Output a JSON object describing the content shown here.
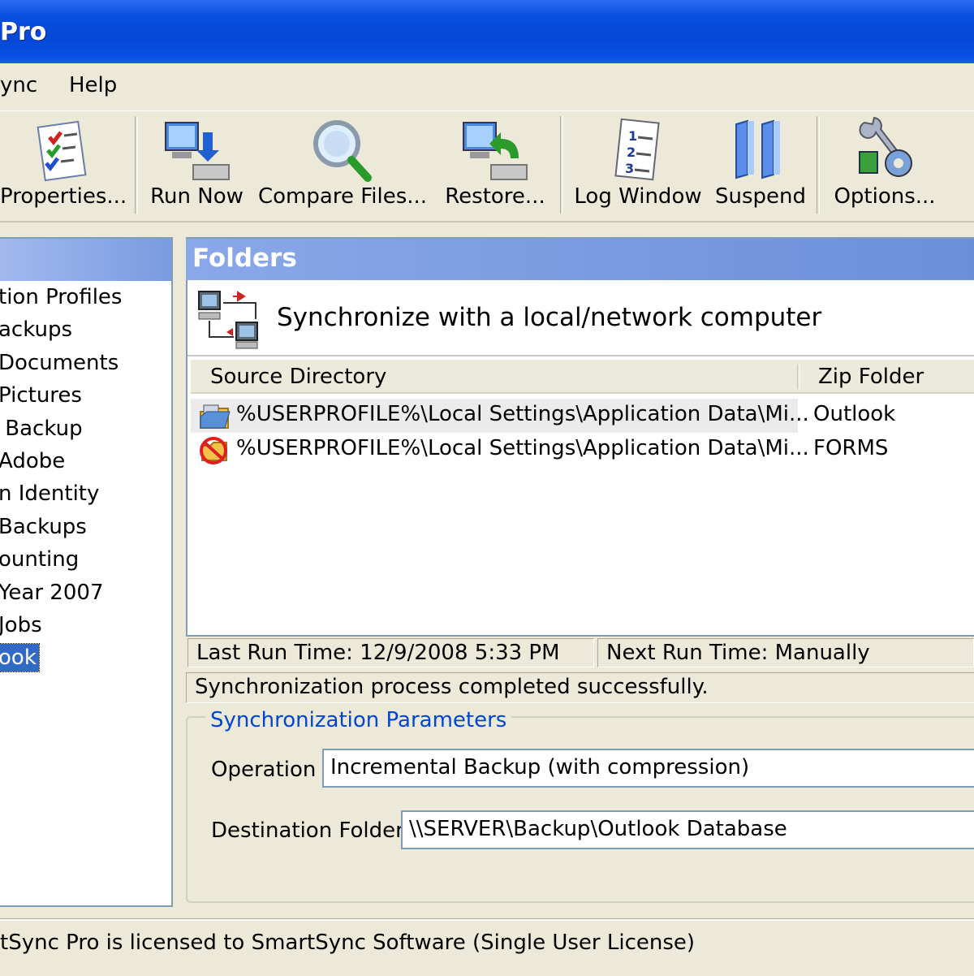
{
  "window": {
    "title": "Pro"
  },
  "menu": [
    "ync",
    "Help"
  ],
  "toolbar": {
    "buttons": [
      {
        "label": "Properties...",
        "icon": "checklist-icon"
      },
      {
        "label": "Run Now",
        "icon": "computer-download-icon"
      },
      {
        "label": "Compare Files...",
        "icon": "magnifier-icon"
      },
      {
        "label": "Restore...",
        "icon": "computer-restore-icon"
      },
      {
        "label": "Log Window",
        "icon": "numbered-log-icon"
      },
      {
        "label": "Suspend",
        "icon": "pause-icon"
      },
      {
        "label": "Options...",
        "icon": "gears-wrench-icon"
      }
    ]
  },
  "profiles": {
    "items": [
      "tion Profiles",
      "ackups",
      "Documents",
      "Pictures",
      " Backup",
      "Adobe",
      "n Identity",
      "Backups",
      "ounting",
      "Year 2007",
      "Jobs",
      "ook"
    ],
    "selected": "ook"
  },
  "folders": {
    "header": "Folders",
    "sync_type": "Synchronize with a local/network computer",
    "columns": {
      "source": "Source Directory",
      "zip": "Zip Folder"
    },
    "rows": [
      {
        "source": "%USERPROFILE%\\Local Settings\\Application Data\\Mi...",
        "zip": "Outlook",
        "icon": "folder-sync-icon"
      },
      {
        "source": "%USERPROFILE%\\Local Settings\\Application Data\\Mi...",
        "zip": "FORMS",
        "icon": "folder-excluded-icon"
      }
    ]
  },
  "status": {
    "last_run": "Last Run Time: 12/9/2008 5:33 PM",
    "next_run": "Next Run Time: Manually",
    "message": "Synchronization process completed successfully."
  },
  "params": {
    "title": "Synchronization Parameters",
    "operation_label": "Operation",
    "operation_value": "Incremental Backup (with compression)",
    "destination_label": "Destination Folder",
    "destination_value": "\\\\SERVER\\Backup\\Outlook Database"
  },
  "statusbar": {
    "text": "tSync Pro is licensed to SmartSync Software (Single User License)"
  },
  "colors": {
    "title_bar": "#0648d8",
    "pane_header": "#7a9be0",
    "selection": "#316ac5",
    "link_blue": "#0046d5"
  }
}
